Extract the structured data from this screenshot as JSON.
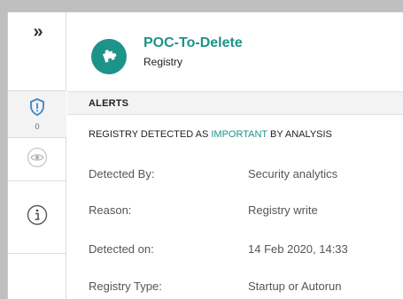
{
  "rail": {
    "expand_glyph": "»",
    "alerts_count": "0",
    "icons": [
      "shield-alert-icon",
      "eye-icon",
      "info-icon"
    ]
  },
  "header": {
    "title": "POC-To-Delete",
    "subtitle": "Registry",
    "avatar_icon": "puzzle-icon"
  },
  "section": {
    "title": "ALERTS"
  },
  "summary": {
    "prefix": "REGISTRY DETECTED AS ",
    "highlight": "IMPORTANT",
    "suffix": " BY ANALYSIS"
  },
  "details": [
    {
      "label": "Detected By:",
      "value": "Security analytics"
    },
    {
      "label": "Reason:",
      "value": "Registry write"
    },
    {
      "label": "Detected on:",
      "value": "14 Feb 2020, 14:33"
    },
    {
      "label": "Registry Type:",
      "value": "Startup or Autorun"
    }
  ],
  "colors": {
    "accent": "#1e9389",
    "shield": "#3a86c8"
  }
}
